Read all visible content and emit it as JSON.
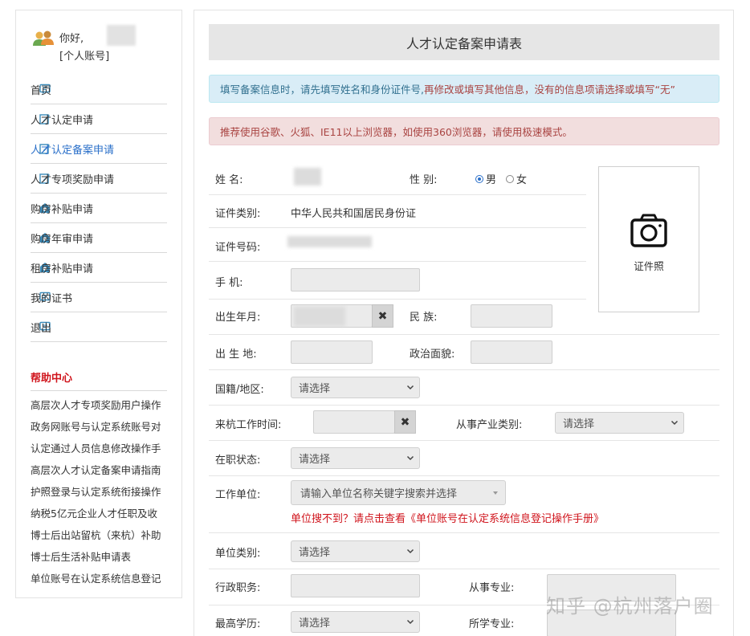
{
  "user": {
    "greeting": "你好,",
    "account_type": "[个人账号]"
  },
  "nav": {
    "items": [
      {
        "label": "首页",
        "icon": "message-icon"
      },
      {
        "label": "人才认定申请",
        "icon": "edit-icon"
      },
      {
        "label": "人才认定备案申请",
        "icon": "edit-icon",
        "active": true
      },
      {
        "label": "人才专项奖励申请",
        "icon": "edit-icon"
      },
      {
        "label": "购房补贴申请",
        "icon": "home-icon"
      },
      {
        "label": "购房年审申请",
        "icon": "home-icon"
      },
      {
        "label": "租房补贴申请",
        "icon": "home-icon"
      },
      {
        "label": "我的证书",
        "icon": "message-icon"
      },
      {
        "label": "退出",
        "icon": "message-icon"
      }
    ],
    "active_color": "#2a6fc9"
  },
  "help": {
    "title": "帮助中心",
    "items": [
      "高层次人才专项奖励用户操作",
      "政务网账号与认定系统账号对",
      "认定通过人员信息修改操作手",
      "高层次人才认定备案申请指南",
      "护照登录与认定系统衔接操作",
      "纳税5亿元企业人才任职及收",
      "博士后出站留杭（来杭）补助",
      "博士后生活补贴申请表",
      "单位账号在认定系统信息登记"
    ]
  },
  "form": {
    "title": "人才认定备案申请表",
    "info_alert": {
      "part1": "填写备案信息时，请先填写姓名和身份证件号,",
      "part2": "再修改或填写其他信息，没有的信息项请选择或填写“无”"
    },
    "danger_alert": "推荐使用谷歌、火狐、IE11以上浏览器，如使用360浏览器，请使用极速模式。",
    "labels": {
      "name": "姓  名:",
      "gender": "性  别:",
      "id_type": "证件类别:",
      "id_number": "证件号码:",
      "phone": "手  机:",
      "birth": "出生年月:",
      "ethnicity": "民  族:",
      "birthplace": "出 生 地:",
      "political": "政治面貌:",
      "nationality": "国籍/地区:",
      "work_time": "来杭工作时间:",
      "industry": "从事产业类别:",
      "job_status": "在职状态:",
      "employer": "工作单位:",
      "unit_type": "单位类别:",
      "admin_post": "行政职务:",
      "specialty": "从事专业:",
      "education": "最高学历:",
      "major": "所学专业:"
    },
    "gender_options": {
      "male": "男",
      "female": "女",
      "selected": "男"
    },
    "id_type_value": "中华人民共和国居民身份证",
    "select_placeholder": "请选择",
    "employer_placeholder": "请输入单位名称关键字搜索并选择",
    "employer_help_link": "单位搜不到？请点击查看《单位账号在认定系统信息登记操作手册》",
    "clear_symbol": "✖",
    "photo_label": "证件照"
  },
  "watermark": "知乎 @杭州落户圈"
}
